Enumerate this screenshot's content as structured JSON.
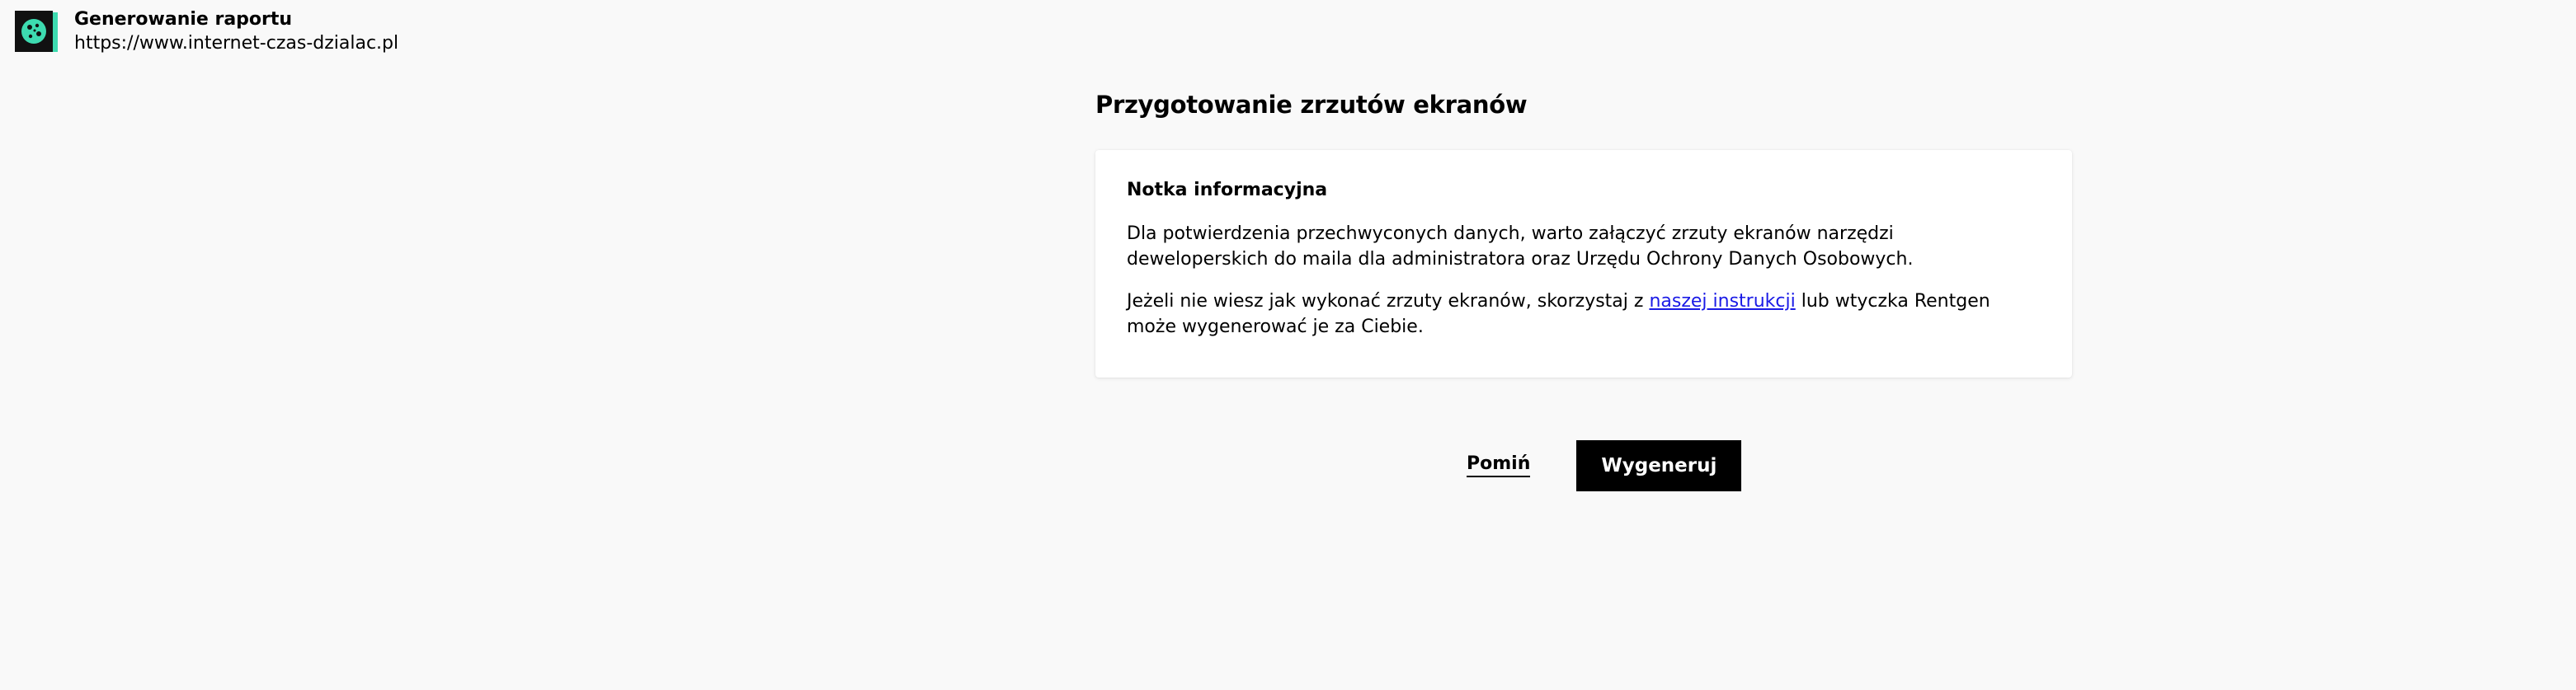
{
  "header": {
    "logo_icon": "cookie-monitor-icon",
    "title": "Generowanie raportu",
    "url": "https://www.internet-czas-dzialac.pl"
  },
  "main": {
    "title": "Przygotowanie zrzutów ekranów",
    "card": {
      "title": "Notka informacyjna",
      "paragraph1": "Dla potwierdzenia przechwyconych danych, warto załączyć zrzuty ekranów narzędzi deweloperskich do maila dla administratora oraz Urzędu Ochrony Danych Osobowych.",
      "paragraph2_before": "Jeżeli nie wiesz jak wykonać zrzuty ekranów, skorzystaj z ",
      "paragraph2_link": "naszej instrukcji",
      "paragraph2_after": " lub wtyczka Rentgen może wygenerować je za Ciebie."
    }
  },
  "actions": {
    "skip_label": "Pomiń",
    "generate_label": "Wygeneruj"
  },
  "colors": {
    "background": "#f9f9f9",
    "link": "#1a1ae6",
    "primary_button": "#000000",
    "logo_accent": "#3ddbb0"
  }
}
